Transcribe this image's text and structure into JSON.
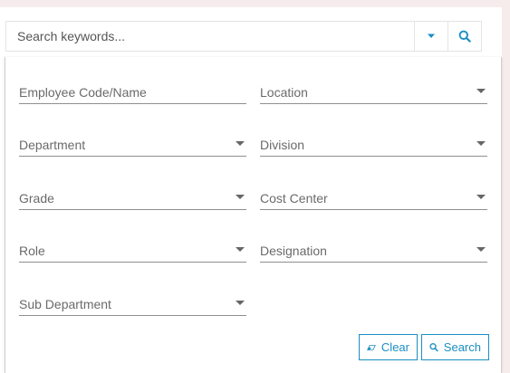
{
  "search": {
    "placeholder": "Search keywords..."
  },
  "filters": {
    "employee": "Employee Code/Name",
    "location": "Location",
    "department": "Department",
    "division": "Division",
    "grade": "Grade",
    "cost_center": "Cost Center",
    "role": "Role",
    "designation": "Designation",
    "sub_department": "Sub Department"
  },
  "actions": {
    "clear_label": "Clear",
    "search_label": "Search"
  },
  "colors": {
    "accent": "#1a8fc2",
    "background": "#f7ecec"
  },
  "icons": {
    "dropdown": "caret-down-icon",
    "search": "search-icon",
    "clear": "eraser-icon"
  }
}
